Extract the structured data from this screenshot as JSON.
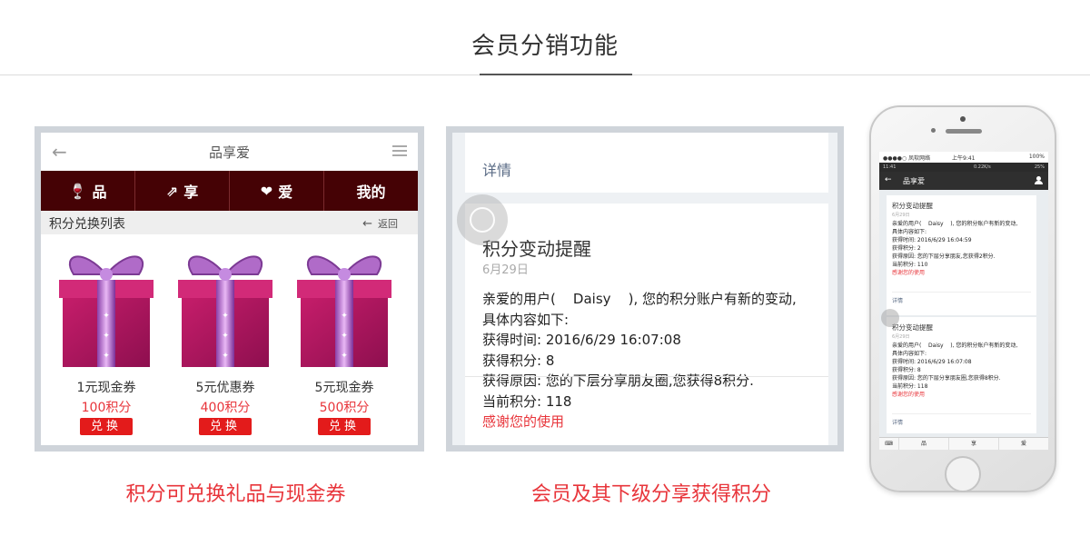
{
  "header": {
    "title": "会员分销功能"
  },
  "panel1": {
    "caption": "积分可兑换礼品与现金券",
    "topbar": {
      "back_icon": "←",
      "title": "品享爱",
      "menu_icon": "hamburger-icon"
    },
    "nav": [
      {
        "icon": "🍷",
        "label": "品"
      },
      {
        "icon": "⇗",
        "label": "享"
      },
      {
        "icon": "❤",
        "label": "爱"
      },
      {
        "icon": "",
        "label": "我的"
      }
    ],
    "section": {
      "title": "积分兑换列表",
      "return_label": "返回",
      "return_icon": "←"
    },
    "gifts": [
      {
        "name": "1元现金券",
        "points": "100积分",
        "button": "兑换"
      },
      {
        "name": "5元优惠券",
        "points": "400积分",
        "button": "兑换"
      },
      {
        "name": "5元现金券",
        "points": "500积分",
        "button": "兑换"
      }
    ],
    "colors": {
      "nav_bg": "#450205",
      "accent": "#e31b1b"
    }
  },
  "panel2": {
    "caption": "会员及其下级分享获得积分",
    "detail_label": "详情",
    "card": {
      "title": "积分变动提醒",
      "date": "6月29日",
      "lines": [
        "亲爱的用户(    Daisy    ), 您的积分账户有新的变动,",
        "具体内容如下:",
        "获得时间: 2016/6/29 16:07:08",
        "获得积分: 8",
        "获得原因: 您的下层分享朋友圈,您获得8积分.",
        "当前积分: 118"
      ],
      "thanks": "感谢您的使用"
    }
  },
  "phone": {
    "status": {
      "carrier": "●●●●○ 凤软网络",
      "time": "上午9:41",
      "battery": "100%"
    },
    "status2": {
      "left": "11:41",
      "speed": "0.22K/s",
      "battery": "25%"
    },
    "app_title": "品享爱",
    "cards": [
      {
        "title": "积分变动提醒",
        "date": "6月29日",
        "lines": [
          "亲爱的用户(    Daisy    ), 您的积分账户有新的变动,",
          "具体内容如下:",
          "获得时间: 2016/6/29 16:04:59",
          "获得积分: 2",
          "获得原因: 您的下层分享朋友,您获得2积分.",
          "当前积分: 110"
        ],
        "thanks": "感谢您的使用",
        "detail": "详情"
      },
      {
        "title": "积分变动提醒",
        "date": "6月29日",
        "lines": [
          "亲爱的用户(    Daisy    ), 您的积分账户有新的变动,",
          "具体内容如下:",
          "获得时间: 2016/6/29 16:07:08",
          "获得积分: 8",
          "获得原因: 您的下层分享朋友圈,您获得8积分.",
          "当前积分: 118"
        ],
        "thanks": "感谢您的使用",
        "detail": "详情"
      }
    ],
    "tabs": [
      "品",
      "享",
      "爱"
    ]
  }
}
